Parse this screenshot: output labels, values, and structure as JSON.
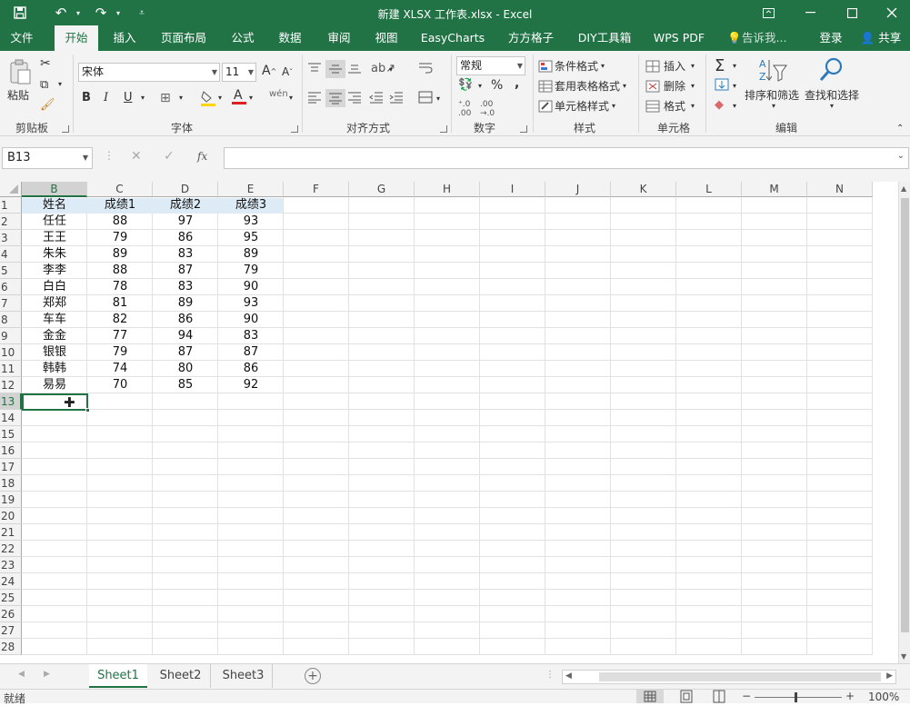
{
  "window": {
    "title": "新建 XLSX 工作表.xlsx - Excel",
    "quick_access": [
      "save-icon",
      "undo-icon",
      "redo-icon",
      "customize-icon"
    ],
    "buttons": [
      "ribbon-display-icon",
      "minimize-icon",
      "maximize-icon",
      "close-icon"
    ]
  },
  "ribbon": {
    "tabs": [
      "文件",
      "开始",
      "插入",
      "页面布局",
      "公式",
      "数据",
      "审阅",
      "视图",
      "EasyCharts",
      "方方格子",
      "DIY工具箱",
      "WPS PDF"
    ],
    "active_tab": "开始",
    "tell_me": "告诉我...",
    "login": "登录",
    "share": "共享",
    "clipboard": {
      "paste": "粘贴",
      "label": "剪贴板"
    },
    "font": {
      "name": "宋体",
      "size": "11",
      "label": "字体",
      "bold": "B",
      "italic": "I",
      "underline": "U"
    },
    "alignment": {
      "label": "对齐方式"
    },
    "number": {
      "format": "常规",
      "label": "数字",
      "percent": "%",
      "comma": ","
    },
    "styles": {
      "conditional": "条件格式",
      "table": "套用表格格式",
      "cell_styles": "单元格样式",
      "label": "样式"
    },
    "cells": {
      "insert": "插入",
      "delete": "删除",
      "format": "格式",
      "label": "单元格"
    },
    "editing": {
      "sort": "排序和筛选",
      "find": "查找和选择",
      "label": "编辑"
    }
  },
  "formula_bar": {
    "name_box": "B13",
    "fx": "fx",
    "value": ""
  },
  "sheet": {
    "columns": [
      "B",
      "C",
      "D",
      "E",
      "F",
      "G",
      "H",
      "I",
      "J",
      "K",
      "L",
      "M",
      "N"
    ],
    "selected_column": "B",
    "rows": [
      "1",
      "2",
      "3",
      "4",
      "5",
      "6",
      "7",
      "8",
      "9",
      "10",
      "11",
      "12",
      "13",
      "14",
      "15",
      "16",
      "17",
      "18",
      "19",
      "20",
      "21",
      "22",
      "23",
      "24",
      "25",
      "26",
      "27",
      "28"
    ],
    "selected_row": "13",
    "header": [
      "姓名",
      "成绩1",
      "成绩2",
      "成绩3"
    ],
    "data": [
      [
        "任任",
        "88",
        "97",
        "93"
      ],
      [
        "王王",
        "79",
        "86",
        "95"
      ],
      [
        "朱朱",
        "89",
        "83",
        "89"
      ],
      [
        "李李",
        "88",
        "87",
        "79"
      ],
      [
        "白白",
        "78",
        "83",
        "90"
      ],
      [
        "郑郑",
        "81",
        "89",
        "93"
      ],
      [
        "车车",
        "82",
        "86",
        "90"
      ],
      [
        "金金",
        "77",
        "94",
        "83"
      ],
      [
        "银银",
        "79",
        "87",
        "87"
      ],
      [
        "韩韩",
        "74",
        "80",
        "86"
      ],
      [
        "易易",
        "70",
        "85",
        "92"
      ]
    ]
  },
  "sheet_tabs": [
    "Sheet1",
    "Sheet2",
    "Sheet3"
  ],
  "active_sheet": "Sheet1",
  "status": {
    "ready": "就绪",
    "zoom": "100%"
  },
  "colors": {
    "accent": "#217346",
    "header_fill": "#ddebf7"
  }
}
